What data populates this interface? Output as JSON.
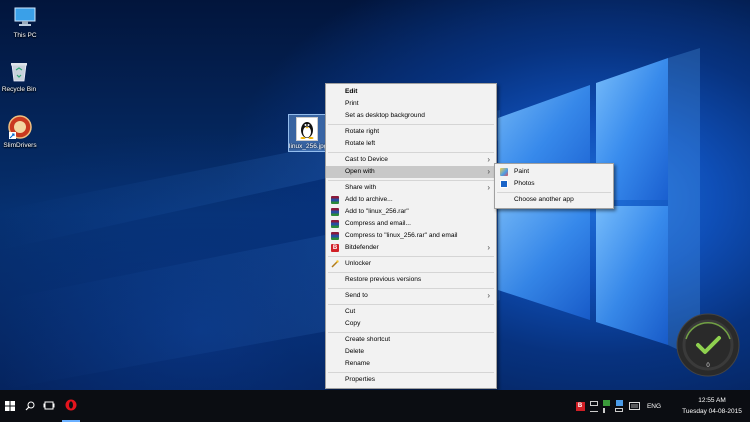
{
  "desktop": {
    "icons": [
      {
        "label": "This PC",
        "icon": "this-pc-icon"
      },
      {
        "label": "Recycle Bin",
        "icon": "recycle-bin-icon"
      },
      {
        "label": "SlimDrivers",
        "icon": "slimdrivers-icon"
      }
    ],
    "selected_file": {
      "label": "linux_256.jpg",
      "icon": "tux-penguin-icon"
    }
  },
  "context_menu": {
    "items": [
      {
        "label": "Edit",
        "bold": true
      },
      {
        "label": "Print"
      },
      {
        "label": "Set as desktop background"
      },
      {
        "label": "Rotate right"
      },
      {
        "label": "Rotate left"
      },
      {
        "label": "Cast to Device",
        "submenu": true
      },
      {
        "label": "Open with",
        "submenu": true,
        "highlighted": true
      },
      {
        "label": "Share with",
        "submenu": true
      },
      {
        "label": "Add to archive...",
        "icon": "winrar-icon"
      },
      {
        "label": "Add to \"linux_256.rar\"",
        "icon": "winrar-icon"
      },
      {
        "label": "Compress and email...",
        "icon": "winrar-icon"
      },
      {
        "label": "Compress to \"linux_256.rar\" and email",
        "icon": "winrar-icon"
      },
      {
        "label": "Bitdefender",
        "icon": "bitdefender-icon",
        "submenu": true
      },
      {
        "label": "Unlocker",
        "icon": "unlocker-wand-icon"
      },
      {
        "label": "Restore previous versions"
      },
      {
        "label": "Send to",
        "submenu": true
      },
      {
        "label": "Cut"
      },
      {
        "label": "Copy"
      },
      {
        "label": "Create shortcut"
      },
      {
        "label": "Delete"
      },
      {
        "label": "Rename"
      },
      {
        "label": "Properties"
      }
    ]
  },
  "open_with_submenu": {
    "items": [
      {
        "label": "Paint",
        "icon": "paint-icon"
      },
      {
        "label": "Photos",
        "icon": "photos-icon"
      },
      {
        "label": "Choose another app"
      }
    ]
  },
  "gauge": {
    "value": "0"
  },
  "taskbar": {
    "language": "ENG",
    "time": "12:55 AM",
    "date": "Tuesday 04-08-2015"
  },
  "colors": {
    "menu_bg": "#f2f2f2",
    "menu_highlight": "#c8c8c8",
    "taskbar_bg": "#0b0d12",
    "wallpaper_blue": "#1f6ed8",
    "gauge_check": "#8fd14f"
  }
}
